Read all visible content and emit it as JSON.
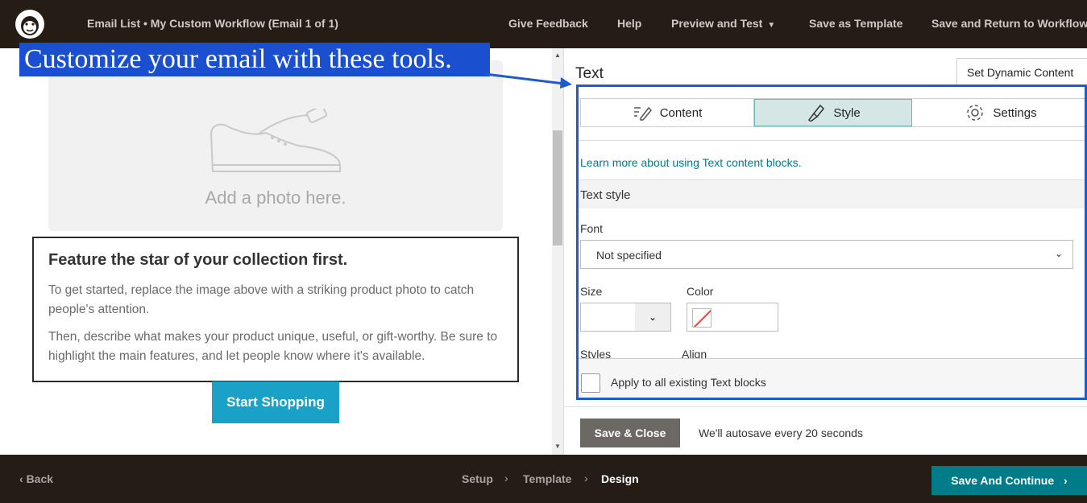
{
  "topbar": {
    "title": "Email List • My Custom Workflow (Email 1 of 1)",
    "nav": {
      "feedback": "Give Feedback",
      "help": "Help",
      "preview": "Preview and Test",
      "save_template": "Save as Template",
      "save_return": "Save and Return to Workflow"
    }
  },
  "callout": "Customize your email with these tools.",
  "preview": {
    "photo_placeholder": "Add a photo here.",
    "heading": "Feature the star of your collection first.",
    "para1": "To get started, replace the image above with a striking product photo to catch people's attention.",
    "para2": "Then, describe what makes your product unique, useful, or gift-worthy. Be sure to highlight the main features, and let people know where it's available.",
    "button": "Start Shopping"
  },
  "editor": {
    "title": "Text",
    "dynamic_button": "Set Dynamic Content",
    "tabs": [
      "Content",
      "Style",
      "Settings"
    ],
    "active_tab": "Style",
    "learn_link": "Learn more about using Text content blocks.",
    "section": "Text style",
    "font_label": "Font",
    "font_value": "Not specified",
    "size_label": "Size",
    "color_label": "Color",
    "styles_label": "Styles",
    "align_label": "Align",
    "apply_label": "Apply to all existing Text blocks",
    "save_button": "Save & Close",
    "autosave": "We'll autosave every 20 seconds"
  },
  "bottombar": {
    "back": "Back",
    "steps": [
      "Setup",
      "Template",
      "Design"
    ],
    "current_step": "Design",
    "continue": "Save And Continue"
  },
  "colors": {
    "chrome": "#241c15",
    "teal": "#007c89",
    "shop_button": "#1aa1c7",
    "highlight": "#1e5bd1"
  }
}
